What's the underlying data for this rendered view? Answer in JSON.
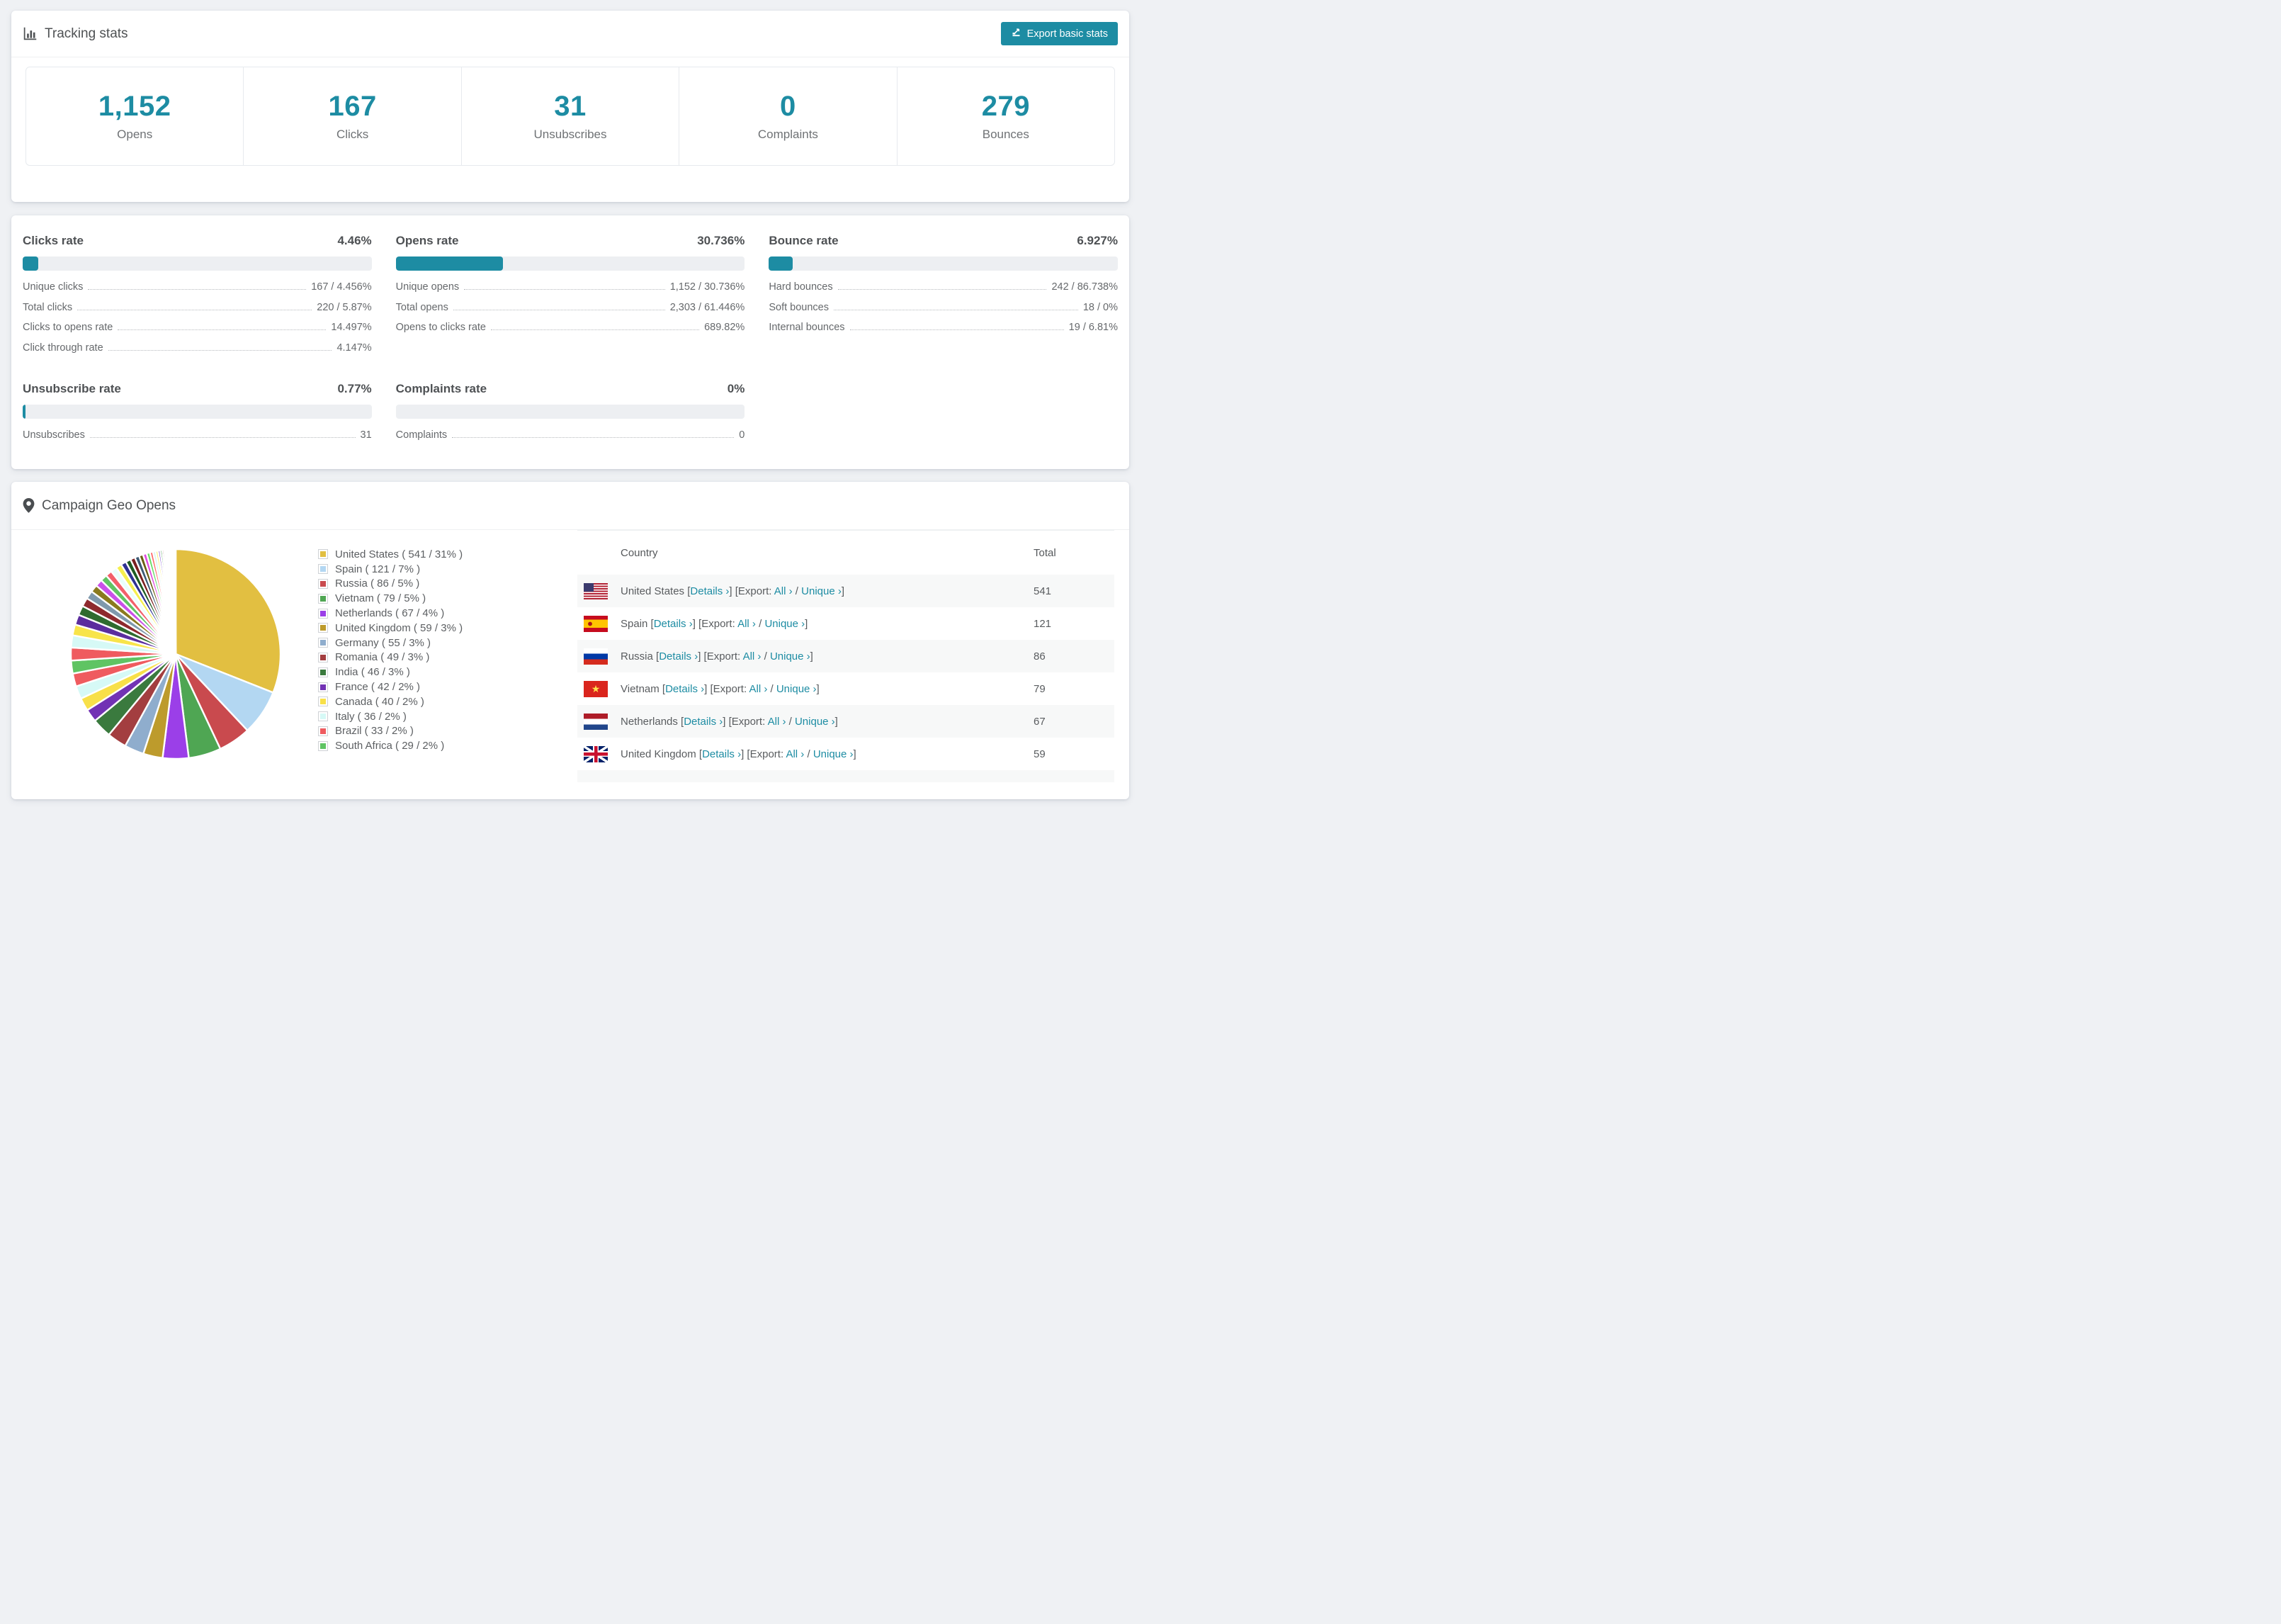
{
  "accent": "#1d8ca3",
  "header": {
    "title": "Tracking stats",
    "export_button": "Export basic stats"
  },
  "summary": [
    {
      "value": "1,152",
      "label": "Opens"
    },
    {
      "value": "167",
      "label": "Clicks"
    },
    {
      "value": "31",
      "label": "Unsubscribes"
    },
    {
      "value": "0",
      "label": "Complaints"
    },
    {
      "value": "279",
      "label": "Bounces"
    }
  ],
  "rates": {
    "sections": [
      {
        "key": "clicks-rate",
        "title": "Clicks rate",
        "value": "4.46%",
        "percent": 4.46,
        "rows": [
          {
            "label": "Unique clicks",
            "value": "167 / 4.456%"
          },
          {
            "label": "Total clicks",
            "value": "220 / 5.87%"
          },
          {
            "label": "Clicks to opens rate",
            "value": "14.497%"
          },
          {
            "label": "Click through rate",
            "value": "4.147%"
          }
        ]
      },
      {
        "key": "opens-rate",
        "title": "Opens rate",
        "value": "30.736%",
        "percent": 30.736,
        "rows": [
          {
            "label": "Unique opens",
            "value": "1,152 / 30.736%"
          },
          {
            "label": "Total opens",
            "value": "2,303 / 61.446%"
          },
          {
            "label": "Opens to clicks rate",
            "value": "689.82%"
          }
        ]
      },
      {
        "key": "bounce-rate",
        "title": "Bounce rate",
        "value": "6.927%",
        "percent": 6.927,
        "rows": [
          {
            "label": "Hard bounces",
            "value": "242 / 86.738%"
          },
          {
            "label": "Soft bounces",
            "value": "18 / 0%"
          },
          {
            "label": "Internal bounces",
            "value": "19 / 6.81%"
          }
        ]
      },
      {
        "key": "unsubscribe-rate",
        "title": "Unsubscribe rate",
        "value": "0.77%",
        "percent": 0.77,
        "rows": [
          {
            "label": "Unsubscribes",
            "value": "31"
          }
        ]
      },
      {
        "key": "complaints-rate",
        "title": "Complaints rate",
        "value": "0%",
        "percent": 0,
        "rows": [
          {
            "label": "Complaints",
            "value": "0"
          }
        ]
      }
    ]
  },
  "geo": {
    "title": "Campaign Geo Opens",
    "chart_data": {
      "type": "pie",
      "start_angle_deg": -90,
      "direction": "clockwise",
      "legend_position": "right",
      "series": [
        {
          "name": "United States",
          "count": 541,
          "pct": 31,
          "color": "#e2bf41",
          "flag": "us"
        },
        {
          "name": "Spain",
          "count": 121,
          "pct": 7,
          "color": "#b3d7f2",
          "flag": "es"
        },
        {
          "name": "Russia",
          "count": 86,
          "pct": 5,
          "color": "#c94a4e",
          "flag": "ru"
        },
        {
          "name": "Vietnam",
          "count": 79,
          "pct": 5,
          "color": "#4fa653",
          "flag": "vn"
        },
        {
          "name": "Netherlands",
          "count": 67,
          "pct": 4,
          "color": "#9b3fe8",
          "flag": "nl"
        },
        {
          "name": "United Kingdom",
          "count": 59,
          "pct": 3,
          "color": "#bd9b2c",
          "flag": "uk"
        },
        {
          "name": "Germany",
          "count": 55,
          "pct": 3,
          "color": "#8fadcd",
          "flag": "de"
        },
        {
          "name": "Romania",
          "count": 49,
          "pct": 3,
          "color": "#a33e40"
        },
        {
          "name": "India",
          "count": 46,
          "pct": 3,
          "color": "#3a7a3e"
        },
        {
          "name": "France",
          "count": 42,
          "pct": 2,
          "color": "#7232b4"
        },
        {
          "name": "Canada",
          "count": 40,
          "pct": 2,
          "color": "#f8e049"
        },
        {
          "name": "Italy",
          "count": 36,
          "pct": 2,
          "color": "#d6f9f6"
        },
        {
          "name": "Brazil",
          "count": 33,
          "pct": 2,
          "color": "#ef5b5f"
        },
        {
          "name": "South Africa",
          "count": 29,
          "pct": 2,
          "color": "#5fc463"
        }
      ],
      "other_slices": {
        "values": [
          1.9,
          1.8,
          1.6,
          1.5,
          1.4,
          1.3,
          1.2,
          1.1,
          1.05,
          1.0,
          0.95,
          0.9,
          0.85,
          0.8,
          0.75,
          0.7,
          0.65,
          0.6,
          0.55,
          0.5,
          0.45,
          0.4,
          0.36,
          0.33,
          0.3,
          0.27,
          0.24,
          0.21,
          0.19,
          0.17,
          0.15,
          0.13,
          0.11,
          0.1,
          0.09,
          0.08,
          0.07,
          0.06,
          0.05,
          0.04
        ],
        "colors": [
          "#ef5b5f",
          "#d6f9f6",
          "#f8e44a",
          "#5b2d9e",
          "#2f6b2f",
          "#8e2a2e",
          "#7f99ad",
          "#8a7a1e",
          "#c950e8",
          "#5fc463",
          "#f2606a",
          "#e8fffb",
          "#f5ef4e",
          "#2e3192",
          "#1e5c22",
          "#7a1f1f",
          "#3c5a74",
          "#6b5e14",
          "#e049e0",
          "#66dd66",
          "#ff6666",
          "#ccf4ee",
          "#ffef66",
          "#7744cc",
          "#228833",
          "#882222",
          "#6688aa",
          "#aa8822",
          "#dd66ff",
          "#88ee88",
          "#ff8888",
          "#ddffff",
          "#ffee77",
          "#8a5be0",
          "#55aa55",
          "#cc4444",
          "#99bbdd",
          "#ccaa33",
          "#ff77ff",
          "#aaffaa"
        ]
      }
    },
    "legend_format": {
      "open": "( ",
      "sep": " / ",
      "pct_suffix": "% )"
    },
    "table": {
      "columns": {
        "country": "Country",
        "total": "Total"
      },
      "links": {
        "bracket_open": "[",
        "bracket_close": "]",
        "details": "Details",
        "export_label": "Export:",
        "all": "All",
        "unique": "Unique",
        "chevron": "›",
        "slash": "/"
      },
      "rows": [
        {
          "flag": "us",
          "country": "United States",
          "total": "541"
        },
        {
          "flag": "es",
          "country": "Spain",
          "total": "121"
        },
        {
          "flag": "ru",
          "country": "Russia",
          "total": "86"
        },
        {
          "flag": "vn",
          "country": "Vietnam",
          "total": "79"
        },
        {
          "flag": "nl",
          "country": "Netherlands",
          "total": "67"
        },
        {
          "flag": "uk",
          "country": "United Kingdom",
          "total": "59"
        }
      ],
      "partial_row_flag": "de"
    }
  }
}
